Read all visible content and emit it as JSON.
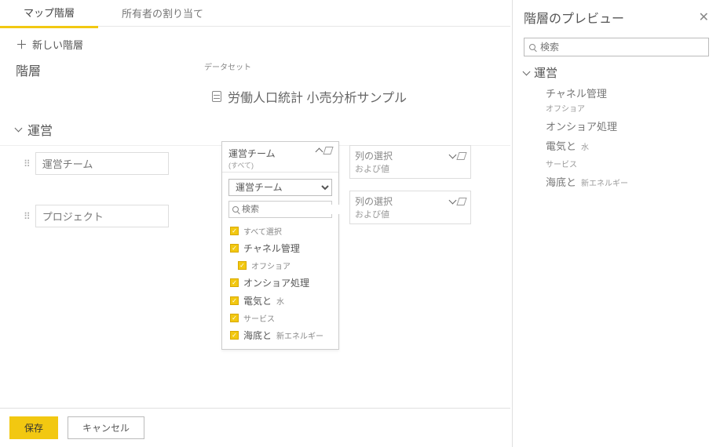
{
  "tabs": {
    "map_hierarchy": "マップ階層",
    "owner_assign": "所有者の割り当て"
  },
  "toolbar": {
    "new_hierarchy": "新しい階層"
  },
  "headings": {
    "hierarchy": "階層",
    "dataset": "データセット"
  },
  "dataset": {
    "name": "労働人口統計 小売分析サンプル"
  },
  "hierarchy": {
    "name": "運営",
    "levels": [
      {
        "label": "運営チーム"
      },
      {
        "label": "プロジェクト"
      }
    ]
  },
  "dropdown": {
    "title": "運営チーム",
    "subtitle": "(すべて)",
    "select_value": "運営チーム",
    "search_placeholder": "検索",
    "select_all": "すべて選択",
    "options": [
      {
        "label": "チャネル管理",
        "children": [
          "オフショア"
        ]
      },
      {
        "label": "オンショア処理",
        "children": []
      },
      {
        "label": "電気と",
        "extra": "水",
        "children": []
      },
      {
        "label": "サービス",
        "children": []
      },
      {
        "label": "海底と",
        "extra": "新エネルギー",
        "children": []
      }
    ]
  },
  "column_select": {
    "line1": "列の選択",
    "line2": "および値"
  },
  "preview": {
    "title": "階層のプレビュー",
    "search_placeholder": "検索",
    "root": "運営",
    "items": [
      {
        "label": "チャネル管理",
        "sub": "オフショア"
      },
      {
        "label": "オンショア処理"
      },
      {
        "label": "電気と",
        "extra": "水"
      },
      {
        "label": "サービス"
      },
      {
        "label": "海底と",
        "extra": "新エネルギー"
      }
    ]
  },
  "footer": {
    "save": "保存",
    "cancel": "キャンセル"
  }
}
